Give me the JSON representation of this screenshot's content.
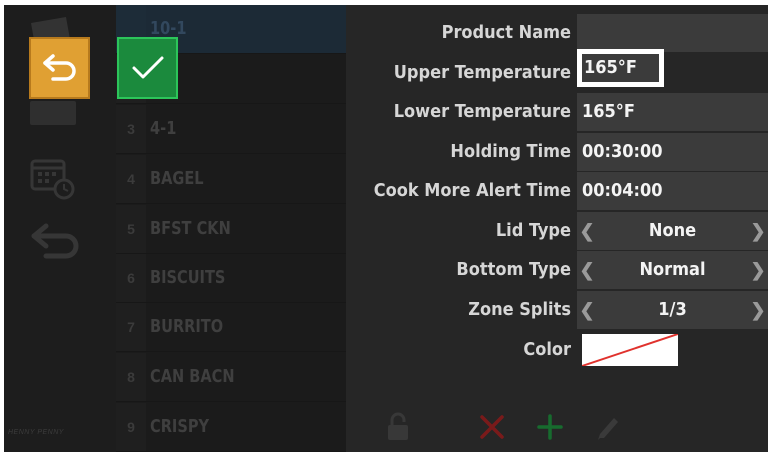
{
  "form": {
    "product_name": {
      "label": "Product Name",
      "value": ""
    },
    "upper_temperature": {
      "label": "Upper Temperature",
      "value": "165°F"
    },
    "lower_temperature": {
      "label": "Lower Temperature",
      "value": "165°F"
    },
    "holding_time": {
      "label": "Holding Time",
      "value": "00:30:00"
    },
    "cook_more_alert_time": {
      "label": "Cook More Alert Time",
      "value": "00:04:00"
    },
    "lid_type": {
      "label": "Lid Type",
      "value": "None"
    },
    "bottom_type": {
      "label": "Bottom Type",
      "value": "Normal"
    },
    "zone_splits": {
      "label": "Zone Splits",
      "value": "1/3"
    },
    "color": {
      "label": "Color"
    }
  },
  "list": {
    "items": [
      {
        "num": "",
        "name": "10-1"
      },
      {
        "num": "",
        "name": ""
      },
      {
        "num": "3",
        "name": "4-1"
      },
      {
        "num": "4",
        "name": "BAGEL"
      },
      {
        "num": "5",
        "name": "BFST CKN"
      },
      {
        "num": "6",
        "name": "BISCUITS"
      },
      {
        "num": "7",
        "name": "BURRITO"
      },
      {
        "num": "8",
        "name": "CAN BACN"
      },
      {
        "num": "9",
        "name": "CRISPY"
      }
    ]
  },
  "brand": "HENNY PENNY",
  "colors": {
    "undo": "#e0a033",
    "confirm": "#1b8a3d",
    "delete": "#7a1a1a",
    "add": "#176b2e"
  }
}
